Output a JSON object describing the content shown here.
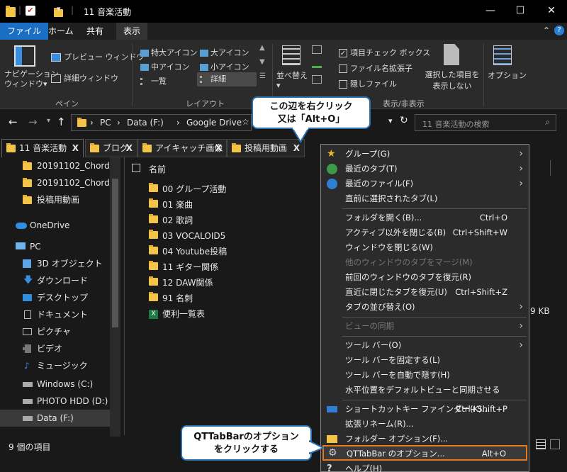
{
  "window": {
    "title": "11 音楽活動",
    "min": "—",
    "max": "☐",
    "close": "✕"
  },
  "ribbon_tabs": [
    "ファイル",
    "ホーム",
    "共有",
    "表示"
  ],
  "ribbon": {
    "nav_pane": "ナビゲーション\nウィンドウ",
    "nav_pane_l1": "ナビゲーション",
    "nav_pane_l2": "ウィンドウ",
    "preview": "プレビュー ウィンドウ",
    "details_pane": "詳細ウィンドウ",
    "group_pane": "ペイン",
    "layout": {
      "xl_icons": "特大アイコン",
      "l_icons": "大アイコン",
      "m_icons": "中アイコン",
      "s_icons": "小アイコン",
      "list": "一覧",
      "details": "詳細",
      "group": "レイアウト"
    },
    "sort": "並べ替え",
    "checkboxes": "項目チェック ボックス",
    "extensions": "ファイル名拡張子",
    "hidden": "隠しファイル",
    "hide_selected_l1": "選択した項目を",
    "hide_selected_l2": "表示しない",
    "options": "オプション",
    "group_showhide": "表示/非表示"
  },
  "address": {
    "path": [
      "PC",
      "Data (F:)",
      "Google Drive"
    ],
    "search_placeholder": "11 音楽活動の検索"
  },
  "tabs": [
    {
      "label": "11 音楽活動"
    },
    {
      "label": "ブログ"
    },
    {
      "label": "アイキャッチ画像"
    },
    {
      "label": "投稿用動画"
    }
  ],
  "nav": [
    {
      "label": "20191102_Chordify"
    },
    {
      "label": "20191102_Chordify"
    },
    {
      "label": "投稿用動画"
    },
    {
      "label": "OneDrive"
    },
    {
      "label": "PC"
    },
    {
      "label": "3D オブジェクト"
    },
    {
      "label": "ダウンロード"
    },
    {
      "label": "デスクトップ"
    },
    {
      "label": "ドキュメント"
    },
    {
      "label": "ピクチャ"
    },
    {
      "label": "ビデオ"
    },
    {
      "label": "ミュージック"
    },
    {
      "label": "Windows (C:)"
    },
    {
      "label": "PHOTO HDD (D:)"
    },
    {
      "label": "Data (F:)"
    }
  ],
  "filelist": {
    "header": "名前",
    "items": [
      "00 グループ活動",
      "01 楽曲",
      "02 歌詞",
      "03 VOCALOID5",
      "04 Youtube投稿",
      "11 ギター関係",
      "12 DAW関係",
      "91 名刺",
      "便利一覧表"
    ],
    "size_fragment": "9 KB"
  },
  "status": {
    "count": "9 個の項目"
  },
  "menu": [
    {
      "label": "グループ(G)",
      "arrow": true
    },
    {
      "label": "最近のタブ(T)",
      "arrow": true
    },
    {
      "label": "最近のファイル(F)",
      "arrow": true
    },
    {
      "label": "直前に選択されたタブ(L)"
    },
    {
      "label": "フォルダを開く(B)...",
      "shortcut": "Ctrl+O"
    },
    {
      "label": "アクティブ以外を閉じる(B)",
      "shortcut": "Ctrl+Shift+W"
    },
    {
      "label": "ウィンドウを閉じる(W)"
    },
    {
      "label": "他のウィンドウのタブをマージ(M)",
      "disabled": true
    },
    {
      "label": "前回のウィンドウのタブを復元(R)"
    },
    {
      "label": "直近に閉じたタブを復元(U)",
      "shortcut": "Ctrl+Shift+Z"
    },
    {
      "label": "タブの並び替え(O)",
      "arrow": true
    },
    {
      "label": "ビューの同期",
      "arrow": true,
      "disabled": true
    },
    {
      "label": "ツール バー(O)",
      "arrow": true
    },
    {
      "label": "ツール バーを固定する(L)"
    },
    {
      "label": "ツール バーを自動で隠す(H)"
    },
    {
      "label": "水平位置をデフォルトビューと同期させる"
    },
    {
      "label": "ショートカットキー ファインダー(K)...",
      "shortcut": "Ctrl+Shift+P"
    },
    {
      "label": "拡張リネーム(R)..."
    },
    {
      "label": "フォルダー オプション(F)..."
    },
    {
      "label": "QTTabBar のオプション...",
      "shortcut": "Alt+O"
    },
    {
      "label": "ヘルプ(H)"
    }
  ],
  "callouts": {
    "top_l1": "この辺を右クリック",
    "top_l2": "又は「Alt+O」",
    "bottom_l1": "QTTabBarのオプション",
    "bottom_l2": "をクリックする"
  },
  "colors": {
    "accent": "#1a6fc4",
    "highlight": "#e8781e",
    "callout_border": "#2a6fb0"
  }
}
